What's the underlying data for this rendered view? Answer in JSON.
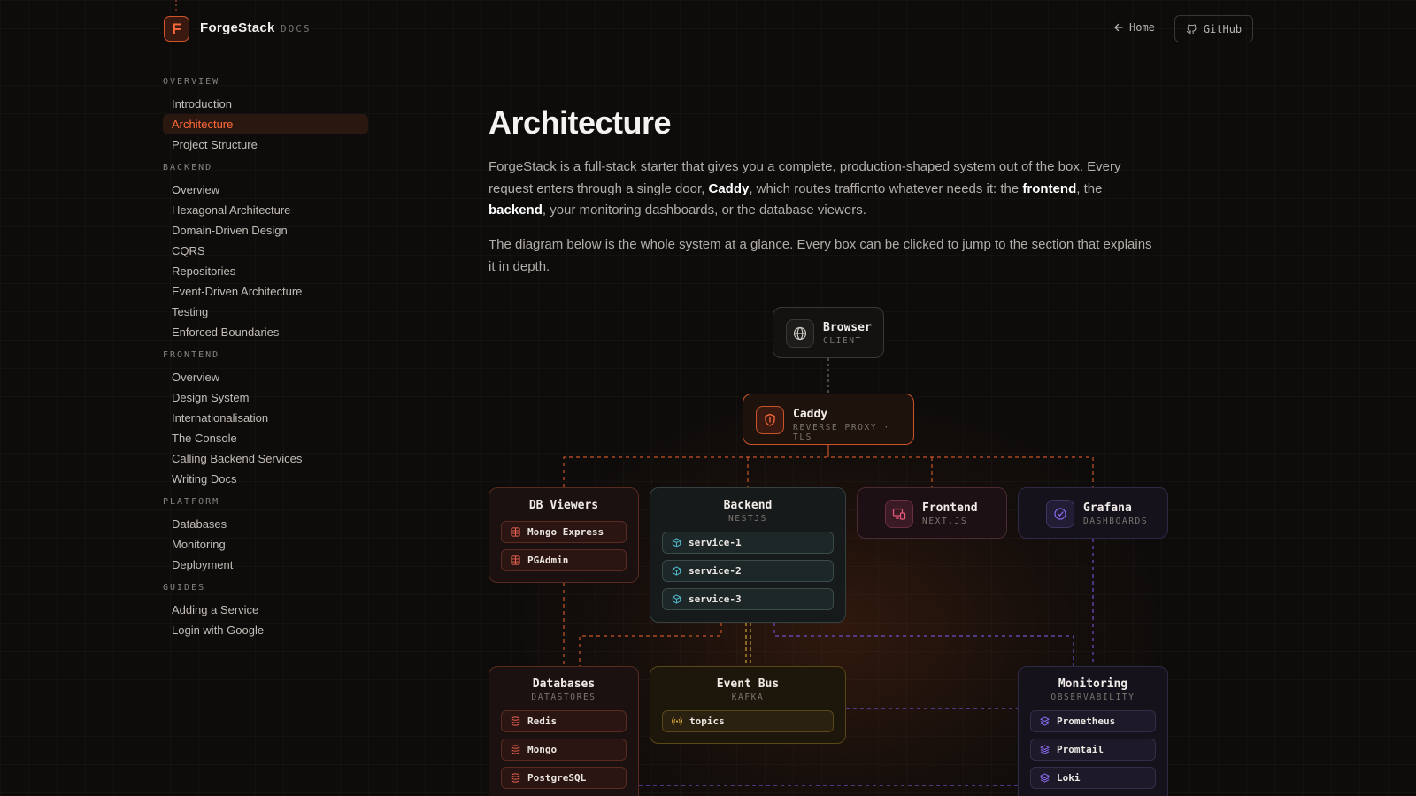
{
  "header": {
    "logo_letter": "F",
    "brand": "ForgeStack",
    "brand_tag": "DOCS",
    "home_label": "Home",
    "github_label": "GitHub"
  },
  "sidebar": {
    "sections": [
      {
        "title": "OVERVIEW",
        "items": [
          "Introduction",
          "Architecture",
          "Project Structure"
        ]
      },
      {
        "title": "BACKEND",
        "items": [
          "Overview",
          "Hexagonal Architecture",
          "Domain-Driven Design",
          "CQRS",
          "Repositories",
          "Event-Driven Architecture",
          "Testing",
          "Enforced Boundaries"
        ]
      },
      {
        "title": "FRONTEND",
        "items": [
          "Overview",
          "Design System",
          "Internationalisation",
          "The Console",
          "Calling Backend Services",
          "Writing Docs"
        ]
      },
      {
        "title": "PLATFORM",
        "items": [
          "Databases",
          "Monitoring",
          "Deployment"
        ]
      },
      {
        "title": "GUIDES",
        "items": [
          "Adding a Service",
          "Login with Google"
        ]
      }
    ],
    "active_item": "Architecture"
  },
  "main": {
    "title": "Architecture",
    "para1": {
      "t1": "ForgeStack is a full-stack starter that gives you a complete, production-shaped system out of the box. Every request enters through a single door, ",
      "b1": "Caddy",
      "t2": ", which routes trafficnto whatever needs it: the ",
      "b2": "frontend",
      "t3": ", the ",
      "b3": "backend",
      "t4": ", your monitoring dashboards, or the database viewers."
    },
    "para2": "The diagram below is the whole system at a glance. Every box can be clicked to jump to the section that explains it in depth."
  },
  "diagram": {
    "browser": {
      "title": "Browser",
      "sub": "CLIENT",
      "icon": "globe-icon"
    },
    "caddy": {
      "title": "Caddy",
      "sub": "REVERSE PROXY · TLS",
      "icon": "shield-icon"
    },
    "db_viewers": {
      "title": "DB Viewers",
      "items": [
        "Mongo Express",
        "PGAdmin"
      ],
      "icon": "table-icon"
    },
    "backend": {
      "title": "Backend",
      "sub": "NESTJS",
      "items": [
        "service-1",
        "service-2",
        "service-3"
      ],
      "icon": "cube-icon"
    },
    "frontend": {
      "title": "Frontend",
      "sub": "NEXT.JS",
      "icon": "devices-icon"
    },
    "grafana": {
      "title": "Grafana",
      "sub": "DASHBOARDS",
      "icon": "gauge-icon"
    },
    "databases": {
      "title": "Databases",
      "sub": "DATASTORES",
      "items": [
        "Redis",
        "Mongo",
        "PostgreSQL"
      ],
      "icon": "database-icon"
    },
    "event_bus": {
      "title": "Event Bus",
      "sub": "KAFKA",
      "items": [
        "topics"
      ],
      "icon": "broadcast-icon"
    },
    "monitoring": {
      "title": "Monitoring",
      "sub": "OBSERVABILITY",
      "items": [
        "Prometheus",
        "Promtail",
        "Loki"
      ],
      "icon": "layers-icon"
    }
  },
  "colors": {
    "accent": "#ff6a3a",
    "caddy_border": "#c9542a",
    "purple_line": "#6d4fc9",
    "yellow_line": "#d3a236"
  }
}
